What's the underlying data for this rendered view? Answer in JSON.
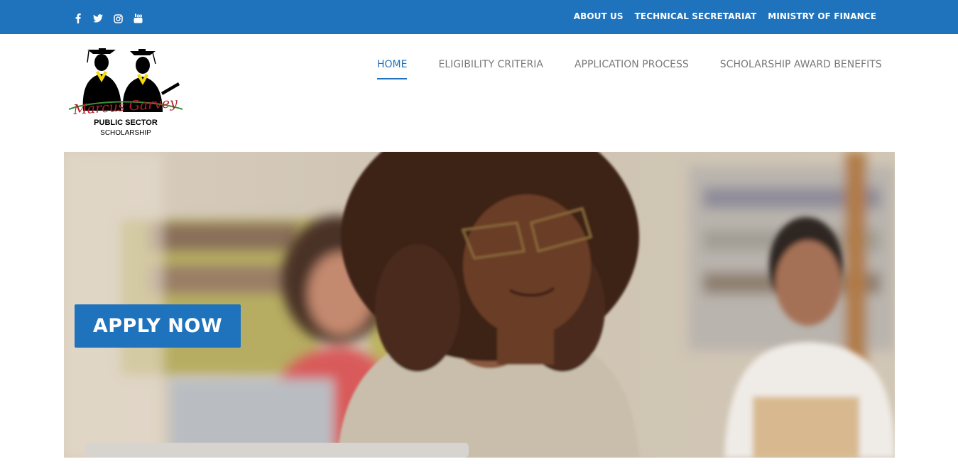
{
  "topbar": {
    "background": "#1f73bd",
    "social_icons": [
      "facebook-icon",
      "twitter-icon",
      "instagram-icon",
      "youtube-icon"
    ],
    "links": [
      "ABOUT US",
      "TECHNICAL SECRETARIAT",
      "MINISTRY OF FINANCE"
    ]
  },
  "logo": {
    "line1": "Marcus Garvey",
    "line2": "PUBLIC SECTOR",
    "line3": "SCHOLARSHIP"
  },
  "nav": {
    "items": [
      "HOME",
      "ELIGIBILITY CRITERIA",
      "APPLICATION PROCESS",
      "SCHOLARSHIP AWARD BENEFITS"
    ],
    "active_index": 0,
    "active_color": "#1f73bd"
  },
  "hero": {
    "apply_label": "APPLY NOW",
    "button_color": "#1f73bd"
  }
}
